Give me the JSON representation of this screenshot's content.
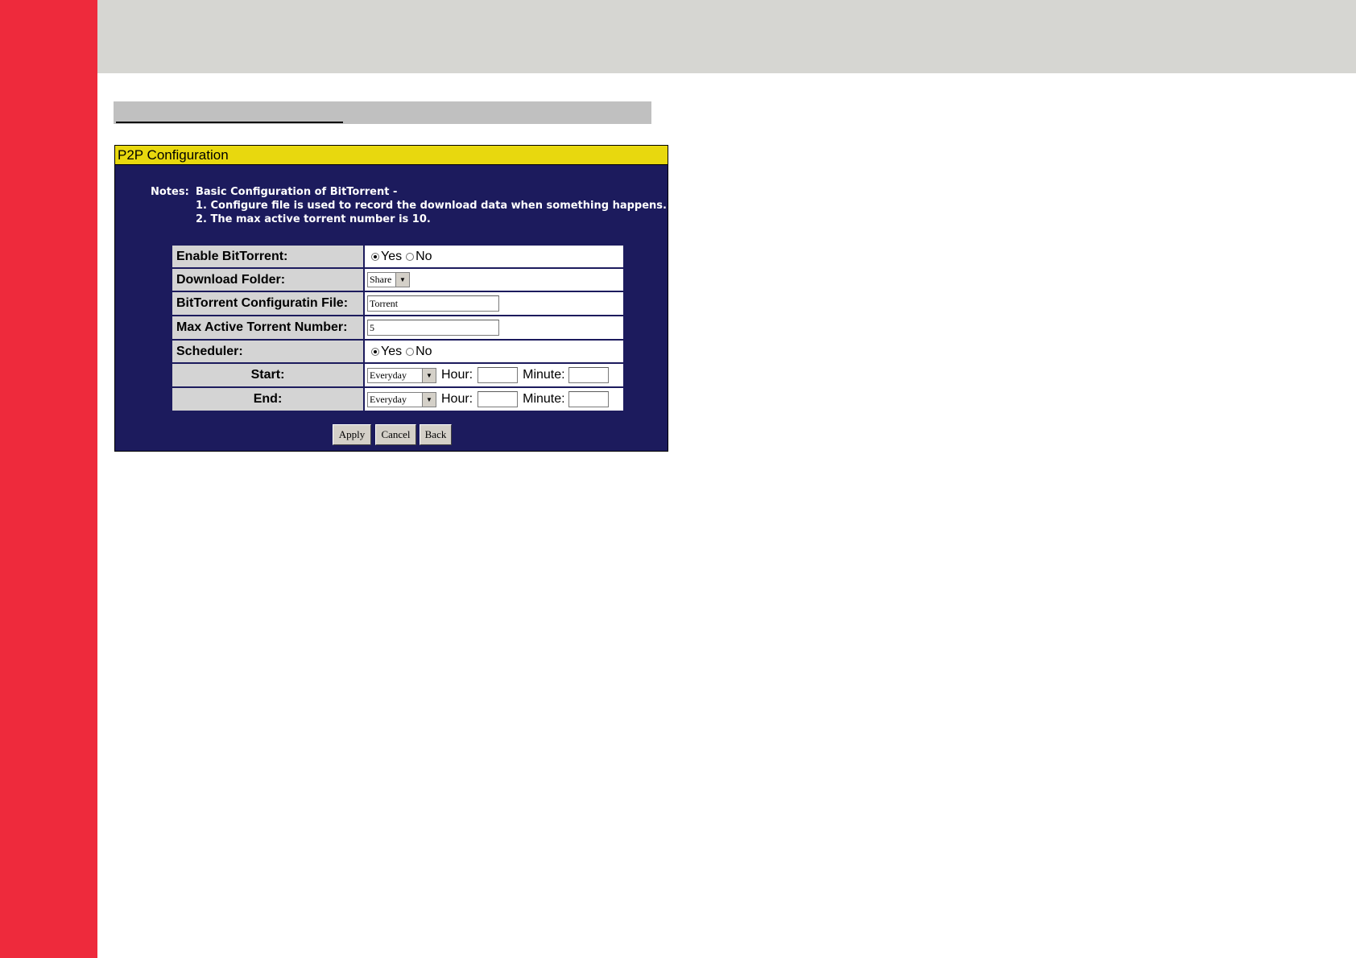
{
  "panel": {
    "title": "P2P Configuration",
    "notes_label": "Notes:",
    "notes": [
      "Basic Configuration of BitTorrent -",
      "1. Configure file is used to record the download data when something happens.",
      "2. The max active torrent number is 10."
    ]
  },
  "form": {
    "enable": {
      "label": "Enable BitTorrent:",
      "yes": "Yes",
      "no": "No",
      "selected": "Yes"
    },
    "folder": {
      "label": "Download Folder:",
      "value": "Share"
    },
    "config_file": {
      "label": "BitTorrent Configuratin File:",
      "value": "Torrent"
    },
    "max_active": {
      "label": "Max Active Torrent Number:",
      "value": "5"
    },
    "scheduler": {
      "label": "Scheduler:",
      "yes": "Yes",
      "no": "No",
      "selected": "Yes"
    },
    "start": {
      "label": "Start:",
      "day": "Everyday",
      "hour_label": "Hour:",
      "minute_label": "Minute:",
      "hour": "",
      "minute": ""
    },
    "end": {
      "label": "End:",
      "day": "Everyday",
      "hour_label": "Hour:",
      "minute_label": "Minute:",
      "hour": "",
      "minute": ""
    }
  },
  "buttons": {
    "apply": "Apply",
    "cancel": "Cancel",
    "back": "Back"
  },
  "colors": {
    "sidebar": "#ee2a3c",
    "header_band": "#d6d6d2",
    "panel_bg": "#1c1b5d",
    "title_bar": "#e8d80e"
  }
}
